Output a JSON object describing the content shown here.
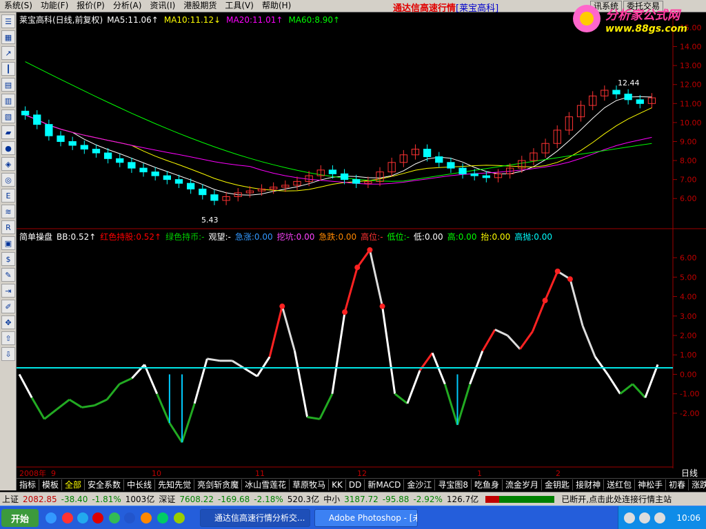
{
  "menu": {
    "items": [
      "系统(S)",
      "功能(F)",
      "报价(P)",
      "分析(A)",
      "资讯(I)",
      "港股期货",
      "工具(V)",
      "帮助(H)"
    ],
    "app_title_prefix": "通达信高速行情",
    "app_title_stock": "[莱宝高科]",
    "right_buttons": [
      "讯系统",
      "委托交易"
    ]
  },
  "logo": {
    "text": "分析家公式网",
    "url": "www.88gs.com"
  },
  "top_legend": {
    "title": "莱宝高科(日线,前复权)",
    "items": [
      {
        "label": "MA5:11.06",
        "arrow": "↑",
        "color": "#ffffff"
      },
      {
        "label": "MA10:11.12",
        "arrow": "↓",
        "color": "#ffff00"
      },
      {
        "label": "MA20:11.01",
        "arrow": "↑",
        "color": "#ff00ff"
      },
      {
        "label": "MA60:8.90",
        "arrow": "↑",
        "color": "#00ff00"
      }
    ]
  },
  "bottom_legend": {
    "title": "简单操盘",
    "items": [
      {
        "label": "BB:0.52",
        "arrow": "↑",
        "color": "#ffffff"
      },
      {
        "label": "红色持股:0.52",
        "arrow": "↑",
        "color": "#ff0000"
      },
      {
        "label": "绿色持币:-",
        "arrow": "",
        "color": "#00cc00"
      },
      {
        "label": "观望:-",
        "arrow": "",
        "color": "#ffffff"
      },
      {
        "label": "急涨:0.00",
        "arrow": "",
        "color": "#3399ff"
      },
      {
        "label": "挖坑:0.00",
        "arrow": "",
        "color": "#ff44ff"
      },
      {
        "label": "急跌:0.00",
        "arrow": "",
        "color": "#ff8800"
      },
      {
        "label": "高位:-",
        "arrow": "",
        "color": "#ff3333"
      },
      {
        "label": "低位:-",
        "arrow": "",
        "color": "#00ff00"
      },
      {
        "label": "低:0.00",
        "arrow": "",
        "color": "#ffffff"
      },
      {
        "label": "高:0.00",
        "arrow": "",
        "color": "#00ff00"
      },
      {
        "label": "抬:0.00",
        "arrow": "",
        "color": "#ffff00"
      },
      {
        "label": "高抛:0.00",
        "arrow": "",
        "color": "#00ffff"
      }
    ]
  },
  "price_axis": [
    "15.00",
    "14.00",
    "13.00",
    "12.00",
    "11.00",
    "10.00",
    "9.00",
    "8.00",
    "7.00",
    "6.00"
  ],
  "indicator_axis": [
    "6.00",
    "5.00",
    "4.00",
    "3.00",
    "2.00",
    "1.00",
    "0.00",
    "-1.00",
    "-2.00"
  ],
  "price_annotations": {
    "high": "12.44",
    "low": "5.43"
  },
  "date_axis": {
    "year": "2008年",
    "months": [
      "9",
      "10",
      "11",
      "12",
      "1",
      "2"
    ],
    "period": "日线"
  },
  "tabs": [
    "指标",
    "模板",
    "全部",
    "安全系数",
    "中长线",
    "先知先觉",
    "亮剑斩贪魔",
    "冰山雪莲花",
    "草原牧马",
    "KK",
    "DD",
    "新MACD",
    "金沙江",
    "寻宝图8",
    "吃鱼身",
    "流金岁月",
    "金钥匙",
    "接财神",
    "送红包",
    "神松手",
    "初春",
    "涨跌幅"
  ],
  "status": {
    "sh_label": "上证",
    "sh_value": "2082.85",
    "sh_change": "-38.40",
    "sh_pct": "-1.81%",
    "sh_amount": "1003亿",
    "sz_label": "深证",
    "sz_value": "7608.22",
    "sz_change": "-169.68",
    "sz_pct": "-2.18%",
    "sz_amount": "520.3亿",
    "zx_label": "中小",
    "zx_value": "3187.72",
    "zx_change": "-95.88",
    "zx_pct": "-2.92%",
    "zx_amount": "126.7亿",
    "connection": "已断开,点击此处连接行情主站"
  },
  "taskbar": {
    "start": "开始",
    "tasks": [
      "通达信高速行情分析交...",
      "Adobe Photoshop - [未..."
    ],
    "clock": "10:06"
  },
  "chart_data": [
    {
      "type": "candlestick",
      "title": "莱宝高科(日线,前复权)",
      "ylim": [
        5.5,
        15.0
      ],
      "x": [
        "2008-09",
        "2008-10",
        "2008-11",
        "2008-12",
        "2009-01",
        "2009-02"
      ],
      "series": [
        {
          "name": "MA5",
          "last": 11.06
        },
        {
          "name": "MA10",
          "last": 11.12
        },
        {
          "name": "MA20",
          "last": 11.01
        },
        {
          "name": "MA60",
          "last": 8.9
        }
      ],
      "close_approx": [
        10.4,
        9.9,
        9.3,
        9.0,
        8.8,
        8.6,
        8.4,
        8.1,
        7.9,
        7.6,
        7.4,
        7.2,
        7.0,
        6.8,
        6.5,
        6.2,
        5.9,
        6.1,
        6.3,
        6.4,
        6.5,
        6.6,
        6.7,
        6.9,
        7.2,
        7.5,
        7.3,
        7.0,
        6.8,
        6.9,
        7.4,
        7.9,
        8.3,
        8.6,
        8.2,
        7.9,
        7.6,
        7.3,
        7.2,
        7.1,
        7.3,
        7.6,
        8.0,
        8.4,
        8.9,
        9.6,
        10.3,
        10.9,
        11.4,
        11.7,
        11.5,
        11.2,
        11.0,
        11.3
      ],
      "high": 12.44,
      "low": 5.43
    },
    {
      "type": "line",
      "title": "简单操盘",
      "ylim": [
        -2.5,
        6.5
      ],
      "series": [
        {
          "name": "BB",
          "last": 0.52
        }
      ],
      "values_approx": [
        0.0,
        -1.2,
        -2.3,
        -1.8,
        -1.3,
        -1.7,
        -1.6,
        -1.3,
        -0.5,
        -0.2,
        0.5,
        -1.0,
        -2.5,
        -3.5,
        -1.5,
        0.8,
        0.7,
        0.7,
        0.3,
        -0.1,
        0.9,
        3.5,
        1.2,
        -2.2,
        -2.3,
        -1.0,
        3.2,
        5.5,
        6.4,
        3.5,
        -1.0,
        -1.5,
        0.2,
        1.1,
        -0.5,
        -2.6,
        -0.5,
        1.2,
        2.3,
        2.0,
        1.3,
        2.2,
        3.8,
        5.3,
        4.9,
        2.5,
        0.9,
        0.0,
        -1.0,
        -0.5,
        -1.2,
        0.5
      ]
    }
  ]
}
